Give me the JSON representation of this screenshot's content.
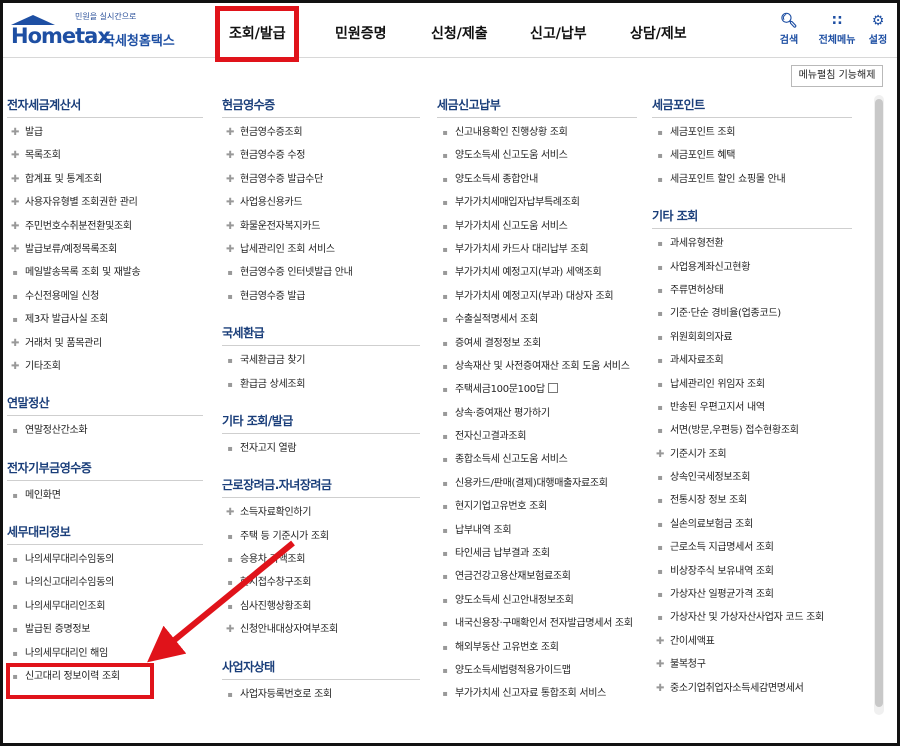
{
  "header": {
    "logo_tag": "민원을 실시간으로",
    "logo_brand": "Hometax",
    "logo_name": "국세청홈택스",
    "nav": [
      "조회/발급",
      "민원증명",
      "신청/제출",
      "신고/납부",
      "상담/제보"
    ],
    "utils": [
      {
        "label": "검색",
        "icon": "search-icon"
      },
      {
        "label": "전체메뉴",
        "icon": "grid-icon"
      },
      {
        "label": "설정",
        "icon": "gear-icon"
      }
    ]
  },
  "expand_button": "메뉴펼침 기능해제",
  "columns": [
    [
      {
        "title": "전자세금계산서",
        "items": [
          {
            "t": "발급",
            "b": "plus"
          },
          {
            "t": "목록조회",
            "b": "plus"
          },
          {
            "t": "합계표 및 통계조회",
            "b": "plus"
          },
          {
            "t": "사용자유형별 조회권한 관리",
            "b": "plus"
          },
          {
            "t": "주민번호수취분전환및조회",
            "b": "plus"
          },
          {
            "t": "발급보류/예정목록조회",
            "b": "plus"
          },
          {
            "t": "메일발송목록 조회 및 재발송",
            "b": "dot"
          },
          {
            "t": "수신전용메일 신청",
            "b": "dot"
          },
          {
            "t": "제3자 발급사실 조회",
            "b": "dot"
          },
          {
            "t": "거래처 및 품목관리",
            "b": "plus"
          },
          {
            "t": "기타조회",
            "b": "plus"
          }
        ]
      },
      {
        "title": "연말정산",
        "items": [
          {
            "t": "연말정산간소화",
            "b": "dot"
          }
        ]
      },
      {
        "title": "전자기부금영수증",
        "items": [
          {
            "t": "메인화면",
            "b": "dot"
          }
        ]
      },
      {
        "title": "세무대리정보",
        "items": [
          {
            "t": "나의세무대리수임동의",
            "b": "dot"
          },
          {
            "t": "나의신고대리수임동의",
            "b": "dot"
          },
          {
            "t": "나의세무대리인조회",
            "b": "dot"
          },
          {
            "t": "발급된 증명정보",
            "b": "dot"
          },
          {
            "t": "나의세무대리인 해임",
            "b": "dot"
          },
          {
            "t": "신고대리 정보이력 조회",
            "b": "dot"
          }
        ]
      }
    ],
    [
      {
        "title": "현금영수증",
        "items": [
          {
            "t": "현금영수증조회",
            "b": "plus"
          },
          {
            "t": "현금영수증 수정",
            "b": "plus"
          },
          {
            "t": "현금영수증 발급수단",
            "b": "plus"
          },
          {
            "t": "사업용신용카드",
            "b": "plus"
          },
          {
            "t": "화물운전자복지카드",
            "b": "plus"
          },
          {
            "t": "납세관리인 조회 서비스",
            "b": "plus"
          },
          {
            "t": "현금영수증 인터넷발급 안내",
            "b": "dot"
          },
          {
            "t": "현금영수증 발급",
            "b": "dot"
          }
        ]
      },
      {
        "title": "국세환급",
        "items": [
          {
            "t": "국세환급금 찾기",
            "b": "dot"
          },
          {
            "t": "환급금 상세조회",
            "b": "dot"
          }
        ]
      },
      {
        "title": "기타 조회/발급",
        "items": [
          {
            "t": "전자고지 열람",
            "b": "dot"
          }
        ]
      },
      {
        "title": "근로장려금.자녀장려금",
        "items": [
          {
            "t": "소득자료확인하기",
            "b": "plus"
          },
          {
            "t": "주택 등 기준시가 조회",
            "b": "dot"
          },
          {
            "t": "승용차 가액조회",
            "b": "dot"
          },
          {
            "t": "현지접수창구조회",
            "b": "dot"
          },
          {
            "t": "심사진행상황조회",
            "b": "dot"
          },
          {
            "t": "신청안내대상자여부조회",
            "b": "plus"
          }
        ]
      },
      {
        "title": "사업자상태",
        "items": [
          {
            "t": "사업자등록번호로 조회",
            "b": "dot"
          }
        ]
      }
    ],
    [
      {
        "title": "세금신고납부",
        "items": [
          {
            "t": "신고내용확인 진행상황 조회",
            "b": "dot"
          },
          {
            "t": "양도소득세 신고도움 서비스",
            "b": "dot"
          },
          {
            "t": "양도소득세 종합안내",
            "b": "dot"
          },
          {
            "t": "부가가치세매입자납부특례조회",
            "b": "dot"
          },
          {
            "t": "부가가치세 신고도움 서비스",
            "b": "dot"
          },
          {
            "t": "부가가치세 카드사 대리납부 조회",
            "b": "dot"
          },
          {
            "t": "부가가치세 예정고지(부과) 세액조회",
            "b": "dot"
          },
          {
            "t": "부가가치세 예정고지(부과) 대상자 조회",
            "b": "dot"
          },
          {
            "t": "수출실적명세서 조회",
            "b": "dot"
          },
          {
            "t": "증여세 결정정보 조회",
            "b": "dot"
          },
          {
            "t": "상속재산 및 사전증여재산 조회 도움 서비스",
            "b": "dot"
          },
          {
            "t": "주택세금100문100답",
            "b": "dot",
            "ext": true
          },
          {
            "t": "상속·증여재산 평가하기",
            "b": "dot"
          },
          {
            "t": "전자신고결과조회",
            "b": "dot"
          },
          {
            "t": "종합소득세 신고도움 서비스",
            "b": "dot"
          },
          {
            "t": "신용카드/판매(결제)대행매출자료조회",
            "b": "dot"
          },
          {
            "t": "현지기업고유번호 조회",
            "b": "dot"
          },
          {
            "t": "납부내역 조회",
            "b": "dot"
          },
          {
            "t": "타인세금 납부결과 조회",
            "b": "dot"
          },
          {
            "t": "연금건강고용산재보험료조회",
            "b": "dot"
          },
          {
            "t": "양도소득세 신고안내정보조회",
            "b": "dot"
          },
          {
            "t": "내국신용장·구매확인서 전자발급명세서 조회",
            "b": "dot"
          },
          {
            "t": "해외부동산 고유번호 조회",
            "b": "dot"
          },
          {
            "t": "양도소득세법령적용가이드맵",
            "b": "dot"
          },
          {
            "t": "부가가치세 신고자료 통합조회 서비스",
            "b": "dot"
          }
        ]
      }
    ],
    [
      {
        "title": "세금포인트",
        "items": [
          {
            "t": "세금포인트 조회",
            "b": "dot"
          },
          {
            "t": "세금포인트 혜택",
            "b": "dot"
          },
          {
            "t": "세금포인트 할인 쇼핑몰 안내",
            "b": "dot"
          }
        ]
      },
      {
        "title": "기타 조회",
        "items": [
          {
            "t": "과세유형전환",
            "b": "dot"
          },
          {
            "t": "사업용계좌신고현황",
            "b": "dot"
          },
          {
            "t": "주류면허상태",
            "b": "dot"
          },
          {
            "t": "기준·단순 경비율(업종코드)",
            "b": "dot"
          },
          {
            "t": "위원회회의자료",
            "b": "dot"
          },
          {
            "t": "과세자료조회",
            "b": "dot"
          },
          {
            "t": "납세관리인 위임자 조회",
            "b": "dot"
          },
          {
            "t": "반송된 우편고지서 내역",
            "b": "dot"
          },
          {
            "t": "서면(방문,우편등) 접수현황조회",
            "b": "dot"
          },
          {
            "t": "기준시가 조회",
            "b": "plus"
          },
          {
            "t": "상속인국세정보조회",
            "b": "dot"
          },
          {
            "t": "전통시장 정보 조회",
            "b": "dot"
          },
          {
            "t": "실손의료보험금 조회",
            "b": "dot"
          },
          {
            "t": "근로소득 지급명세서 조회",
            "b": "dot"
          },
          {
            "t": "비상장주식 보유내역 조회",
            "b": "dot"
          },
          {
            "t": "가상자산 일평균가격 조회",
            "b": "dot"
          },
          {
            "t": "가상자산 및 가상자산사업자 코드 조회",
            "b": "dot"
          },
          {
            "t": "간이세액표",
            "b": "plus"
          },
          {
            "t": "불복청구",
            "b": "plus"
          },
          {
            "t": "중소기업취업자소득세감면명세서",
            "b": "plus"
          }
        ]
      }
    ]
  ],
  "annotation_color": "#e0131a",
  "accent_color": "#1e4fa3"
}
